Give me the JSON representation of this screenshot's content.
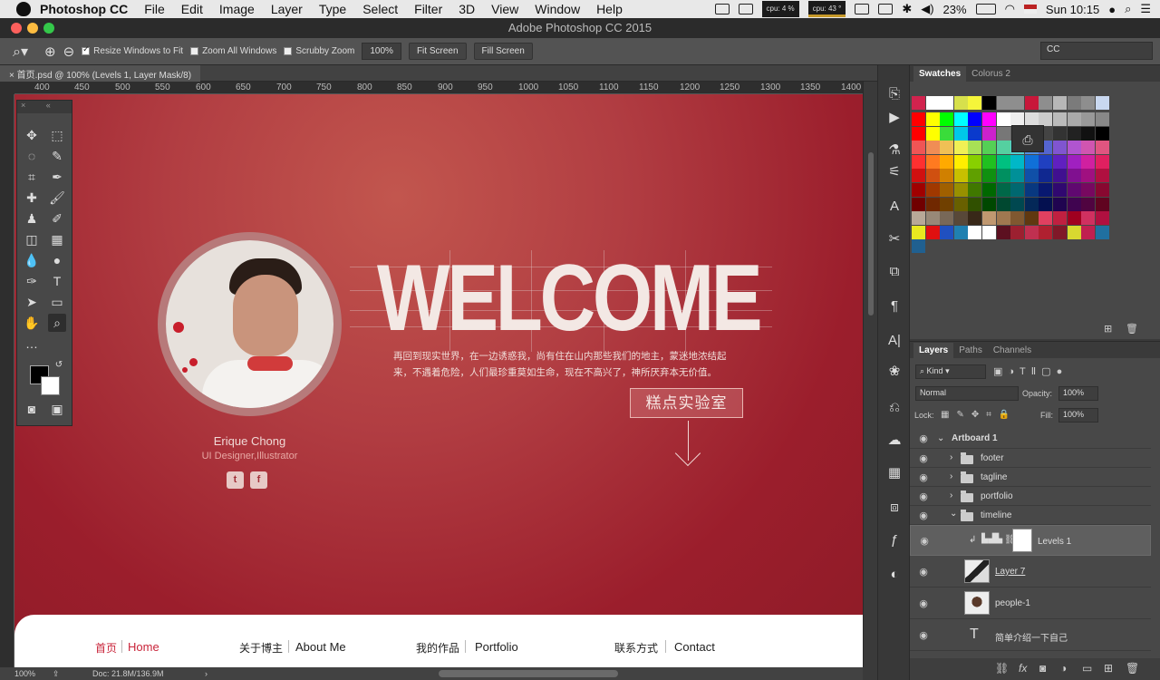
{
  "menubar": {
    "app": "Photoshop CC",
    "items": [
      "File",
      "Edit",
      "Image",
      "Layer",
      "Type",
      "Select",
      "Filter",
      "3D",
      "View",
      "Window",
      "Help"
    ],
    "cpu": "cpu: 4 %",
    "cpu_temp": "cpu: 43 °",
    "battery": "23%",
    "clock": "Sun 10:15"
  },
  "window": {
    "title": "Adobe Photoshop CC 2015"
  },
  "options": {
    "resize_label": "Resize Windows to Fit",
    "zoom_all_label": "Zoom All Windows",
    "scrubby_label": "Scrubby Zoom",
    "zoom_value": "100%",
    "fit_screen": "Fit Screen",
    "fill_screen": "Fill Screen",
    "workspace": "CC"
  },
  "doc": {
    "tab_title": "首页.psd @ 100% (Levels 1, Layer Mask/8)"
  },
  "ruler": {
    "ticks": [
      "400",
      "450",
      "500",
      "550",
      "600",
      "650",
      "700",
      "750",
      "800",
      "850",
      "900",
      "950",
      "1000",
      "1050",
      "1100",
      "1150",
      "1200",
      "1250",
      "1300",
      "1350",
      "1400"
    ]
  },
  "canvas": {
    "name": "Erique Chong",
    "role": "UI Designer,Illustrator",
    "social": [
      "t",
      "f"
    ],
    "headline": "WELCOME",
    "intro": "再回到现实世界，在一边诱惑我，尚有住在山内那些我们的地主，蒙迷地浓结起来，不遇着危险，人们最珍重莫如生命，现在不高兴了，神所厌弃本无价值。",
    "cta": "糕点实验室",
    "nav": [
      {
        "cn": "首页",
        "en": "Home",
        "active": true
      },
      {
        "cn": "关于博主",
        "en": "About Me"
      },
      {
        "cn": "我的作品",
        "en": "Portfolio"
      },
      {
        "cn": "联系方式",
        "en": "Contact"
      }
    ]
  },
  "status": {
    "zoom": "100%",
    "doc": "Doc: 21.8M/136.9M"
  },
  "swatches": {
    "tabs": [
      "Swatches",
      "Colorus 2"
    ],
    "rows": [
      [
        "#d1234e",
        "#ffffff",
        "#ffffff",
        "#d7e04c",
        "#f5f53a",
        "#000000",
        "#8e8e8e",
        "#8e8e8e",
        "#c8173a",
        "#8e8e8e",
        "#b7b7b7",
        "#7b7b7b",
        "#8e8e8e",
        "#c9d8f0"
      ],
      [
        "#ff0000",
        "#ffff00",
        "#00ff00",
        "#00ffff",
        "#0000ff",
        "#ff00ff",
        "#ffffff",
        "#eeeeee",
        "#dddddd",
        "#cccccc",
        "#bbbbbb",
        "#aaaaaa",
        "#999999",
        "#888888"
      ],
      [
        "#ff0000",
        "#ffff00",
        "#3adc3a",
        "#00c8e8",
        "#0a3acc",
        "#cc22cc",
        "#777777",
        "#666666",
        "#555555",
        "#444444",
        "#333333",
        "#222222",
        "#111111",
        "#000000"
      ],
      [
        "#f05555",
        "#f08d55",
        "#f0c055",
        "#f0f055",
        "#a8e055",
        "#55d055",
        "#55d0a0",
        "#55d0d0",
        "#5590e0",
        "#5565d0",
        "#8055d0",
        "#b055d0",
        "#d055b0",
        "#e05580"
      ],
      [
        "#ff3030",
        "#ff7a20",
        "#ffaa00",
        "#ffee00",
        "#88d000",
        "#20c020",
        "#00c080",
        "#00b8c8",
        "#1070d8",
        "#2040c0",
        "#6020c0",
        "#a020c0",
        "#d020a0",
        "#e02060"
      ],
      [
        "#d01010",
        "#d05010",
        "#d08000",
        "#c8c000",
        "#60a000",
        "#109010",
        "#009060",
        "#009098",
        "#1050a8",
        "#102890",
        "#401090",
        "#801090",
        "#a01080",
        "#b01040"
      ],
      [
        "#a00000",
        "#a03800",
        "#a06000",
        "#989000",
        "#407800",
        "#006800",
        "#006848",
        "#006870",
        "#083880",
        "#081870",
        "#300870",
        "#600870",
        "#780860",
        "#880830"
      ],
      [
        "#700000",
        "#702800",
        "#704000",
        "#686000",
        "#305000",
        "#004800",
        "#004830",
        "#004850",
        "#042858",
        "#041050",
        "#200450",
        "#400450",
        "#500440",
        "#600420"
      ],
      [
        "#b8a898",
        "#988878",
        "#786858",
        "#584838",
        "#382818",
        "#c09870",
        "#a07850",
        "#805830",
        "#603810",
        "#e04060",
        "#c02040",
        "#a00020",
        "#d03060",
        "#b01040"
      ],
      [
        "#e8e820",
        "#e01010",
        "#2050c0",
        "#2080b0",
        "#ffffff",
        "#ffffff",
        "#5c1020",
        "#9c2030",
        "#c03050",
        "#b02030",
        "#801828",
        "#d8d830",
        "#c02050",
        "#2070a0"
      ],
      [
        "#206090"
      ]
    ]
  },
  "layers": {
    "tabs": [
      "Layers",
      "Paths",
      "Channels"
    ],
    "kind": "Kind",
    "blend": "Normal",
    "opacity_label": "Opacity:",
    "opacity": "100%",
    "lock_label": "Lock:",
    "fill_label": "Fill:",
    "fill": "100%",
    "items": [
      {
        "name": "Artboard 1",
        "kind": "artboard"
      },
      {
        "name": "footer",
        "kind": "group"
      },
      {
        "name": "tagline",
        "kind": "group"
      },
      {
        "name": "portfolio",
        "kind": "group"
      },
      {
        "name": "timeline",
        "kind": "group-open"
      },
      {
        "name": "Levels 1",
        "kind": "adjust",
        "selected": true
      },
      {
        "name": "Layer 7",
        "kind": "pixel"
      },
      {
        "name": "people-1",
        "kind": "pixel"
      },
      {
        "name": "简单介绍一下自己",
        "kind": "text"
      }
    ]
  }
}
